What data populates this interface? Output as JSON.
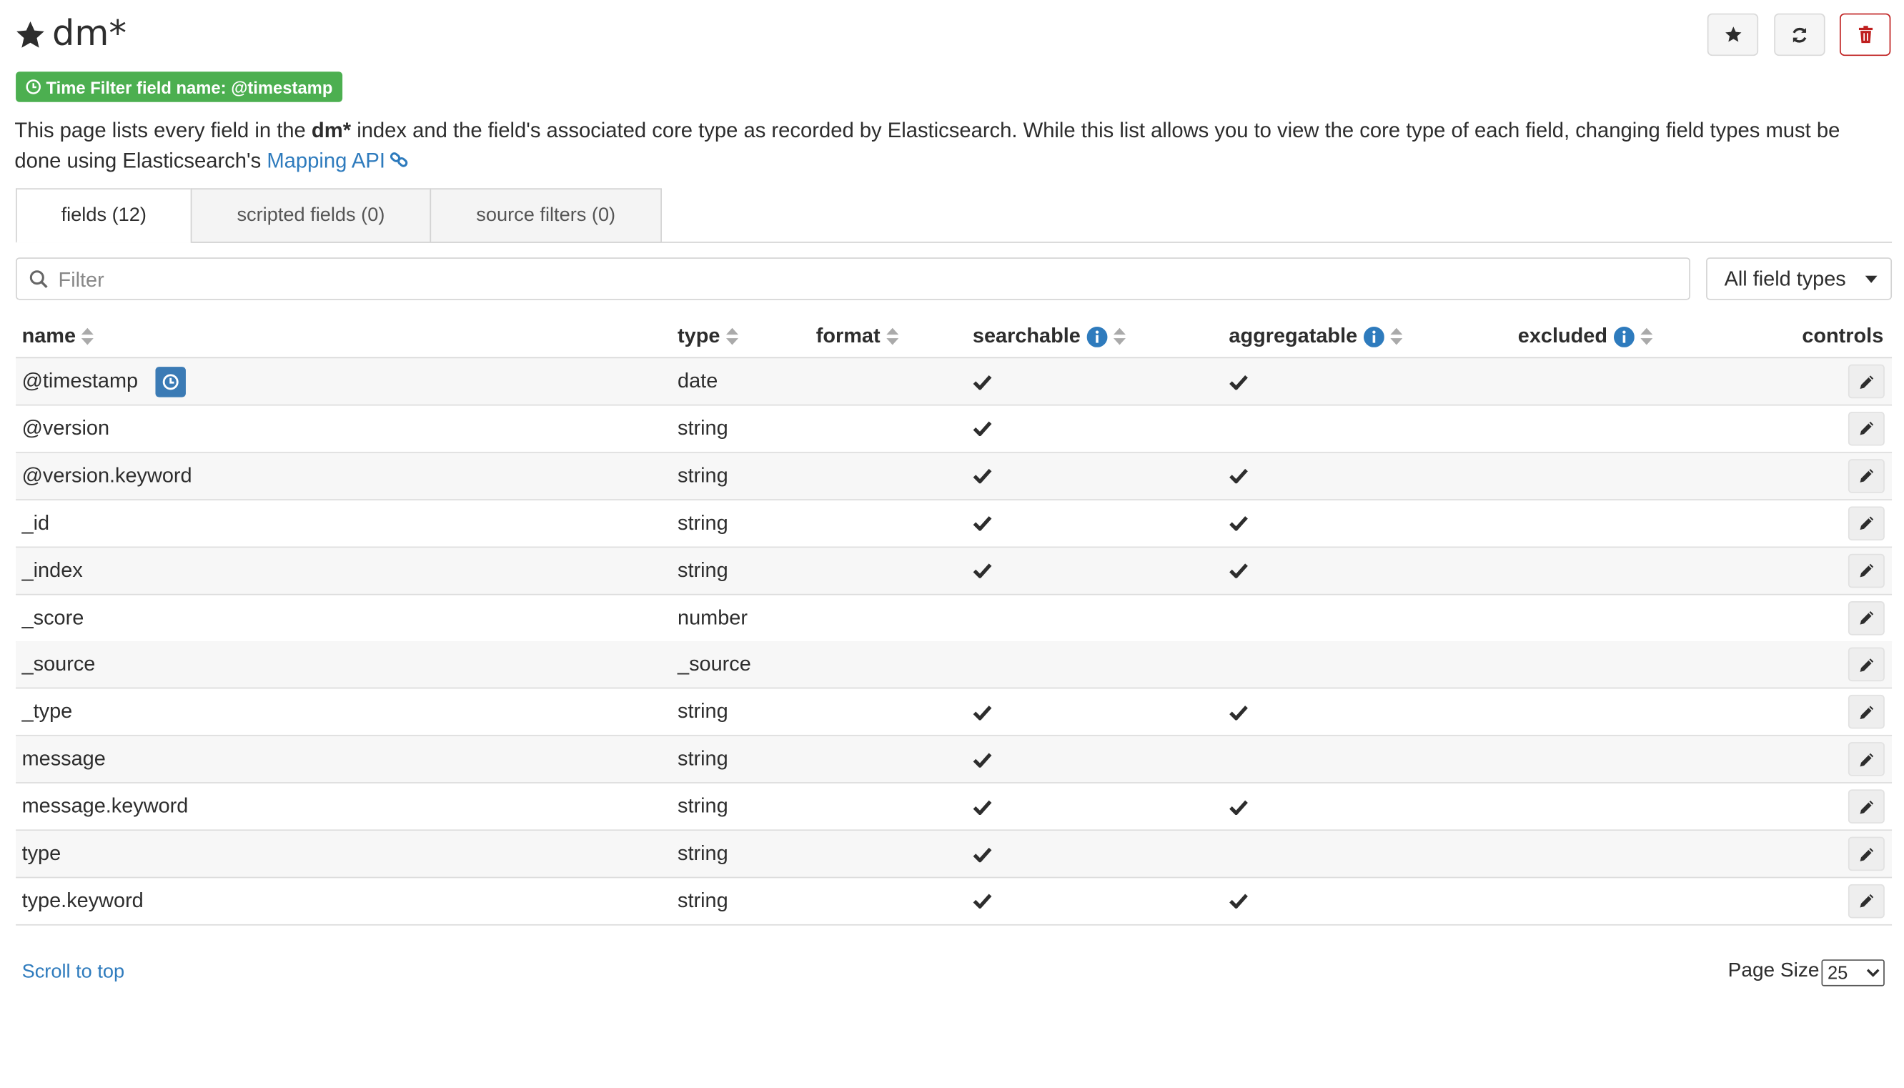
{
  "header": {
    "title": "dm*",
    "buttons": [
      {
        "name": "favorite",
        "icon": "star-icon"
      },
      {
        "name": "refresh",
        "icon": "refresh-icon"
      },
      {
        "name": "delete",
        "icon": "trash-icon"
      }
    ]
  },
  "time_filter_badge": "Time Filter field name: @timestamp",
  "description": {
    "part1": "This page lists every field in the ",
    "index": "dm*",
    "part2": " index and the field's associated core type as recorded by Elasticsearch. While this list allows you to view the core type of each field, changing field types must be done using Elasticsearch's ",
    "link": "Mapping API"
  },
  "tabs": [
    {
      "label": "fields (12)",
      "active": true
    },
    {
      "label": "scripted fields (0)",
      "active": false
    },
    {
      "label": "source filters (0)",
      "active": false
    }
  ],
  "filter": {
    "placeholder": "Filter",
    "value": ""
  },
  "field_type_select": "All field types",
  "columns": {
    "name": "name",
    "type": "type",
    "format": "format",
    "searchable": "searchable",
    "aggregatable": "aggregatable",
    "excluded": "excluded",
    "controls": "controls"
  },
  "rows": [
    {
      "name": "@timestamp",
      "type": "date",
      "searchable": true,
      "aggregatable": true,
      "time_field": true
    },
    {
      "name": "@version",
      "type": "string",
      "searchable": true,
      "aggregatable": false
    },
    {
      "name": "@version.keyword",
      "type": "string",
      "searchable": true,
      "aggregatable": true
    },
    {
      "name": "_id",
      "type": "string",
      "searchable": true,
      "aggregatable": true
    },
    {
      "name": "_index",
      "type": "string",
      "searchable": true,
      "aggregatable": true
    },
    {
      "name": "_score",
      "type": "number",
      "searchable": false,
      "aggregatable": false
    },
    {
      "name": "_source",
      "type": "_source",
      "searchable": false,
      "aggregatable": false
    },
    {
      "name": "_type",
      "type": "string",
      "searchable": true,
      "aggregatable": true
    },
    {
      "name": "message",
      "type": "string",
      "searchable": true,
      "aggregatable": false
    },
    {
      "name": "message.keyword",
      "type": "string",
      "searchable": true,
      "aggregatable": true
    },
    {
      "name": "type",
      "type": "string",
      "searchable": true,
      "aggregatable": false
    },
    {
      "name": "type.keyword",
      "type": "string",
      "searchable": true,
      "aggregatable": true
    }
  ],
  "footer": {
    "scroll_top": "Scroll to top",
    "page_size_label": "Page Size",
    "page_size_value": "25"
  },
  "colors": {
    "accent": "#2e7bbd",
    "badge_green": "#4caf50",
    "danger": "#bf1f1f",
    "time_badge": "#3b7bb5"
  }
}
